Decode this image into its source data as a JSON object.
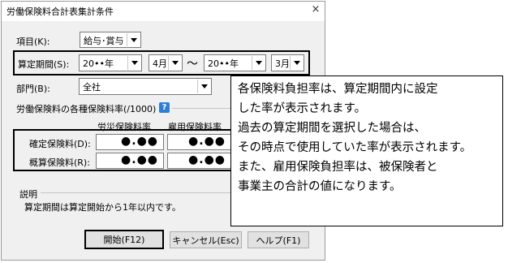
{
  "window": {
    "title": "労働保険料合計表集計条件",
    "close_label": "×"
  },
  "fields": {
    "item_label": "項目(K):",
    "item_value": "給与･賞与",
    "period_label": "算定期間(S):",
    "period_start_year": "20••年",
    "period_start_month": "4月",
    "period_separator": "～",
    "period_end_year": "20••年",
    "period_end_month": "3月",
    "department_label": "部門(B):",
    "department_value": "全社"
  },
  "rates": {
    "group_title": "労働保険料の各種保険料率(/1000)",
    "help_icon": "?",
    "col_workers_comp": "労災保険料率",
    "col_employment": "雇用保険料率",
    "row_confirmed": "確定保険料(D):",
    "row_estimated": "概算保険料(R):",
    "confirmed_workers_comp": "●.●●",
    "confirmed_employment": "●.●●",
    "estimated_workers_comp": "●.●●",
    "estimated_employment": "●.●●"
  },
  "description": {
    "group_title": "説明",
    "text": "算定期間は算定開始から1年以内です。"
  },
  "buttons": {
    "start": "開始(F12)",
    "cancel": "キャンセル(Esc)",
    "help": "ヘルプ(F1)"
  },
  "callout": {
    "lines": [
      "各保険料負担率は、算定期間内に設定",
      "した率が表示されます。",
      "過去の算定期間を選択した場合は、",
      "その時点で使用していた率が表示されます。",
      "また、雇用保険負担率は、被保険者と",
      "事業主の合計の値になります。"
    ]
  }
}
